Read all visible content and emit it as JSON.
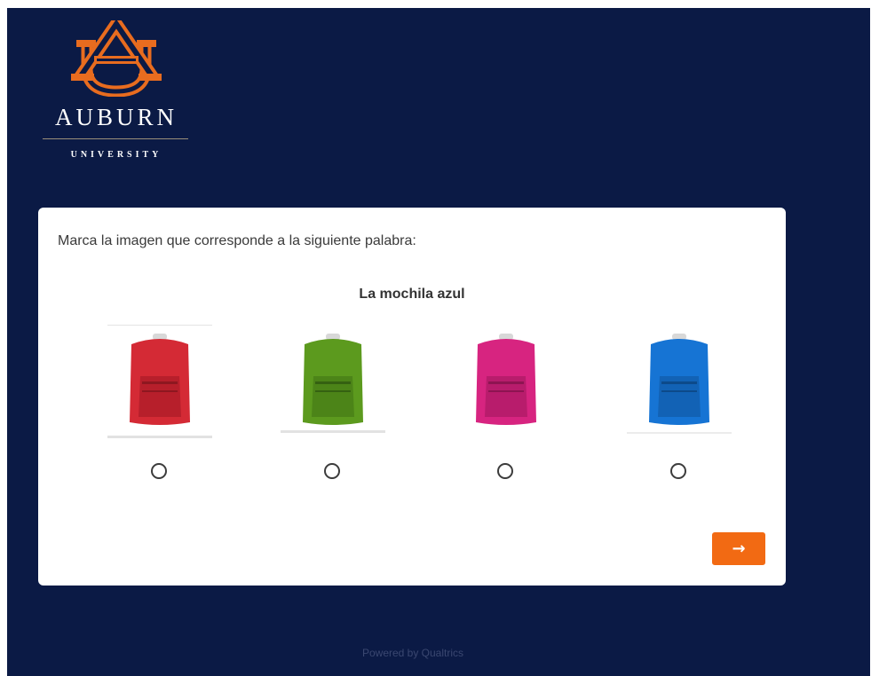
{
  "logo": {
    "wordmark": "AUBURN",
    "subtitle": "UNIVERSITY",
    "monogram_colors": {
      "orange": "#e86c1f",
      "navy": "#0b1a45"
    }
  },
  "survey": {
    "question": "Marca la imagen que corresponde a la siguiente palabra:",
    "target_word": "La mochila azul",
    "choices": [
      {
        "icon": "red-backpack-icon",
        "color": "#d42a35",
        "selected": false
      },
      {
        "icon": "green-backpack-icon",
        "color": "#5c9a1e",
        "selected": false
      },
      {
        "icon": "pink-backpack-icon",
        "color": "#d72480",
        "selected": false
      },
      {
        "icon": "blue-backpack-icon",
        "color": "#1674d4",
        "selected": false
      }
    ],
    "next_label": "→"
  },
  "footer": {
    "text": "Powered by Qualtrics"
  },
  "colors": {
    "background": "#0b1a45",
    "accent": "#f26a13",
    "card": "#ffffff"
  }
}
